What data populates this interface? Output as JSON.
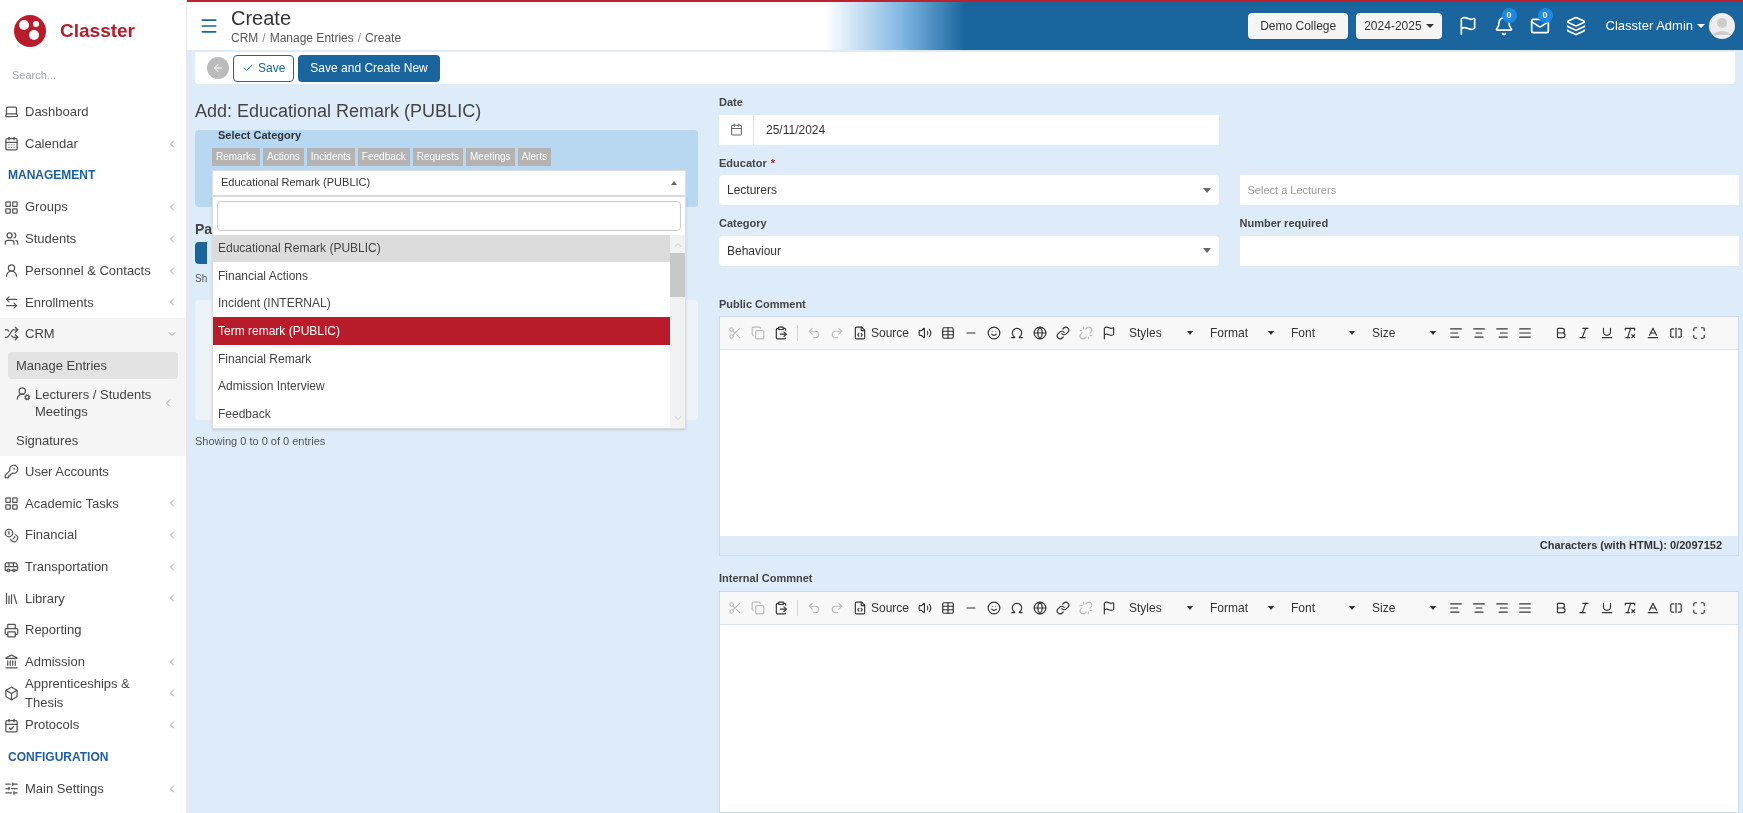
{
  "sidebar": {
    "logo": "Classter",
    "search_placeholder": "Search...",
    "items": [
      {
        "kind": "link",
        "label": "Dashboard",
        "expandable": false
      },
      {
        "kind": "link",
        "label": "Calendar",
        "expandable": true,
        "expanded": false
      },
      {
        "kind": "section",
        "label": "MANAGEMENT"
      },
      {
        "kind": "link",
        "label": "Groups",
        "expandable": true,
        "expanded": false
      },
      {
        "kind": "link",
        "label": "Students",
        "expandable": true,
        "expanded": false
      },
      {
        "kind": "link",
        "label": "Personnel & Contacts",
        "expandable": true,
        "expanded": false
      },
      {
        "kind": "link",
        "label": "Enrollments",
        "expandable": true,
        "expanded": false
      },
      {
        "kind": "link",
        "label": "CRM",
        "expandable": true,
        "expanded": true,
        "children": [
          {
            "label": "Manage Entries",
            "selected": true,
            "expandable": false
          },
          {
            "label": "Lecturers / Students Meetings",
            "selected": false,
            "expandable": true
          },
          {
            "label": "Signatures",
            "selected": false,
            "expandable": false
          }
        ]
      },
      {
        "kind": "link",
        "label": "User Accounts",
        "expandable": false
      },
      {
        "kind": "link",
        "label": "Academic Tasks",
        "expandable": true,
        "expanded": false
      },
      {
        "kind": "link",
        "label": "Financial",
        "expandable": true,
        "expanded": false
      },
      {
        "kind": "link",
        "label": "Transportation",
        "expandable": true,
        "expanded": false
      },
      {
        "kind": "link",
        "label": "Library",
        "expandable": true,
        "expanded": false
      },
      {
        "kind": "link",
        "label": "Reporting",
        "expandable": false
      },
      {
        "kind": "link",
        "label": "Admission",
        "expandable": true,
        "expanded": false
      },
      {
        "kind": "link",
        "label": "Apprenticeships & Thesis",
        "expandable": true,
        "expanded": false
      },
      {
        "kind": "link",
        "label": "Protocols",
        "expandable": true,
        "expanded": false
      },
      {
        "kind": "section",
        "label": "CONFIGURATION"
      },
      {
        "kind": "link",
        "label": "Main Settings",
        "expandable": true,
        "expanded": false
      }
    ]
  },
  "header": {
    "title": "Create",
    "breadcrumb": [
      {
        "kind": "link",
        "text": "CRM"
      },
      {
        "kind": "separator",
        "text": "/"
      },
      {
        "kind": "link",
        "text": "Manage Entries"
      },
      {
        "kind": "separator",
        "text": "/"
      },
      {
        "kind": "current",
        "text": "Create"
      }
    ],
    "school": "Demo College",
    "year": "2024-2025",
    "notifications": "0",
    "messages": "0",
    "user": "Classter Admin"
  },
  "toolbar": {
    "save": "Save",
    "save_new": "Save and Create New"
  },
  "form_title": "Add: Educational Remark (PUBLIC)",
  "category_panel": {
    "label": "Select Category",
    "tabs": [
      "Remarks",
      "Actions",
      "Incidents",
      "Feedback",
      "Requests",
      "Meetings",
      "Alerts"
    ],
    "value": "Educational Remark (PUBLIC)",
    "options": [
      {
        "label": "Educational Remark (PUBLIC)",
        "selected": true,
        "highlighted": false
      },
      {
        "label": "Financial Actions",
        "selected": false,
        "highlighted": false
      },
      {
        "label": "Incident (INTERNAL)",
        "selected": false,
        "highlighted": false
      },
      {
        "label": "Term remark (PUBLIC)",
        "selected": false,
        "highlighted": true
      },
      {
        "label": "Financial Remark",
        "selected": false,
        "highlighted": false
      },
      {
        "label": "Admission Interview",
        "selected": false,
        "highlighted": false
      },
      {
        "label": "Feedback",
        "selected": false,
        "highlighted": false
      }
    ]
  },
  "covered": {
    "heading": "Pa",
    "text": "Sh",
    "footer": "Showing 0 to 0 of 0 entries"
  },
  "fields": {
    "date_label": "Date",
    "date": "25/11/2024",
    "educator_label": "Educator",
    "educator_required": "*",
    "educator": "Lecturers",
    "lecturer_placeholder": "Select a Lecturers",
    "category_label": "Category",
    "category": "Behaviour",
    "number_label": "Number required"
  },
  "editors": [
    {
      "label": "Public Comment",
      "footer": "Characters (with HTML): 0/2097152",
      "toolbar": {
        "source": "Source",
        "dropdowns": [
          "Styles",
          "Format",
          "Font",
          "Size"
        ],
        "clipboard_disabled": true,
        "history_disabled": true,
        "unlink_disabled": true
      }
    },
    {
      "label": "Internal Commnet",
      "toolbar": {
        "source": "Source",
        "dropdowns": [
          "Styles",
          "Format",
          "Font",
          "Size"
        ],
        "clipboard_disabled": true,
        "history_disabled": true,
        "unlink_disabled": true
      }
    }
  ]
}
